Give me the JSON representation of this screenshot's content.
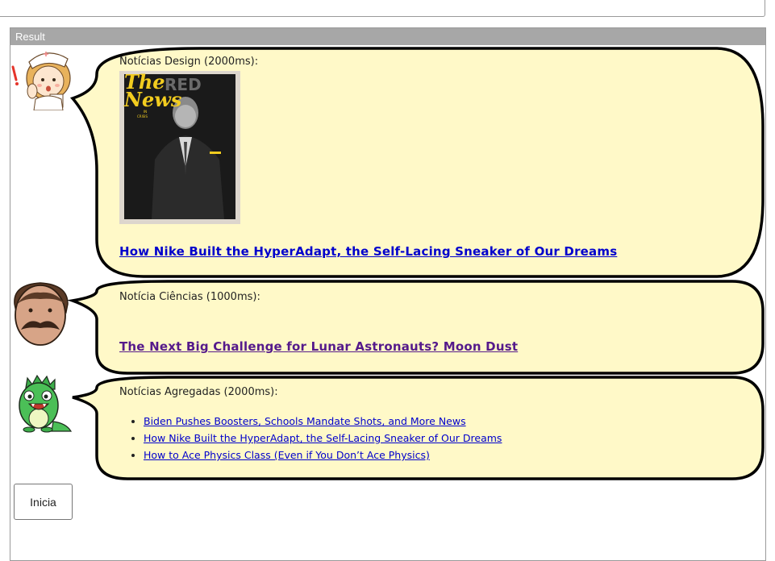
{
  "result_panel": {
    "title": "Result"
  },
  "messages": [
    {
      "avatar": "nurse-avatar",
      "label": "Notícias Design (2000ms):",
      "image": {
        "masthead": "RED",
        "title_line1": "The",
        "title_line2": "News",
        "subtitle": "IN",
        "subtitle2": "CRISIS"
      },
      "link": "How Nike Built the HyperAdapt, the Self-Lacing Sneaker of Our Dreams"
    },
    {
      "avatar": "mustache-man-avatar",
      "label": "Notícia Ciências (1000ms):",
      "link": "The Next Big Challenge for Lunar Astronauts? Moon Dust"
    },
    {
      "avatar": "green-monster-avatar",
      "label": "Notícias Agregadas (2000ms):",
      "links": [
        "Biden Pushes Boosters, Schools Mandate Shots, and More News",
        "How Nike Built the HyperAdapt, the Self-Lacing Sneaker of Our Dreams",
        "How to Ace Physics Class (Even if You Don’t Ace Physics)"
      ]
    }
  ],
  "buttons": {
    "start_label": "Inicia"
  },
  "colors": {
    "bubble_fill": "#fff9c8",
    "bubble_stroke": "#000000",
    "header_bg": "#a7a7a7",
    "link": "#0000cc",
    "visited_link": "#551a8b"
  }
}
